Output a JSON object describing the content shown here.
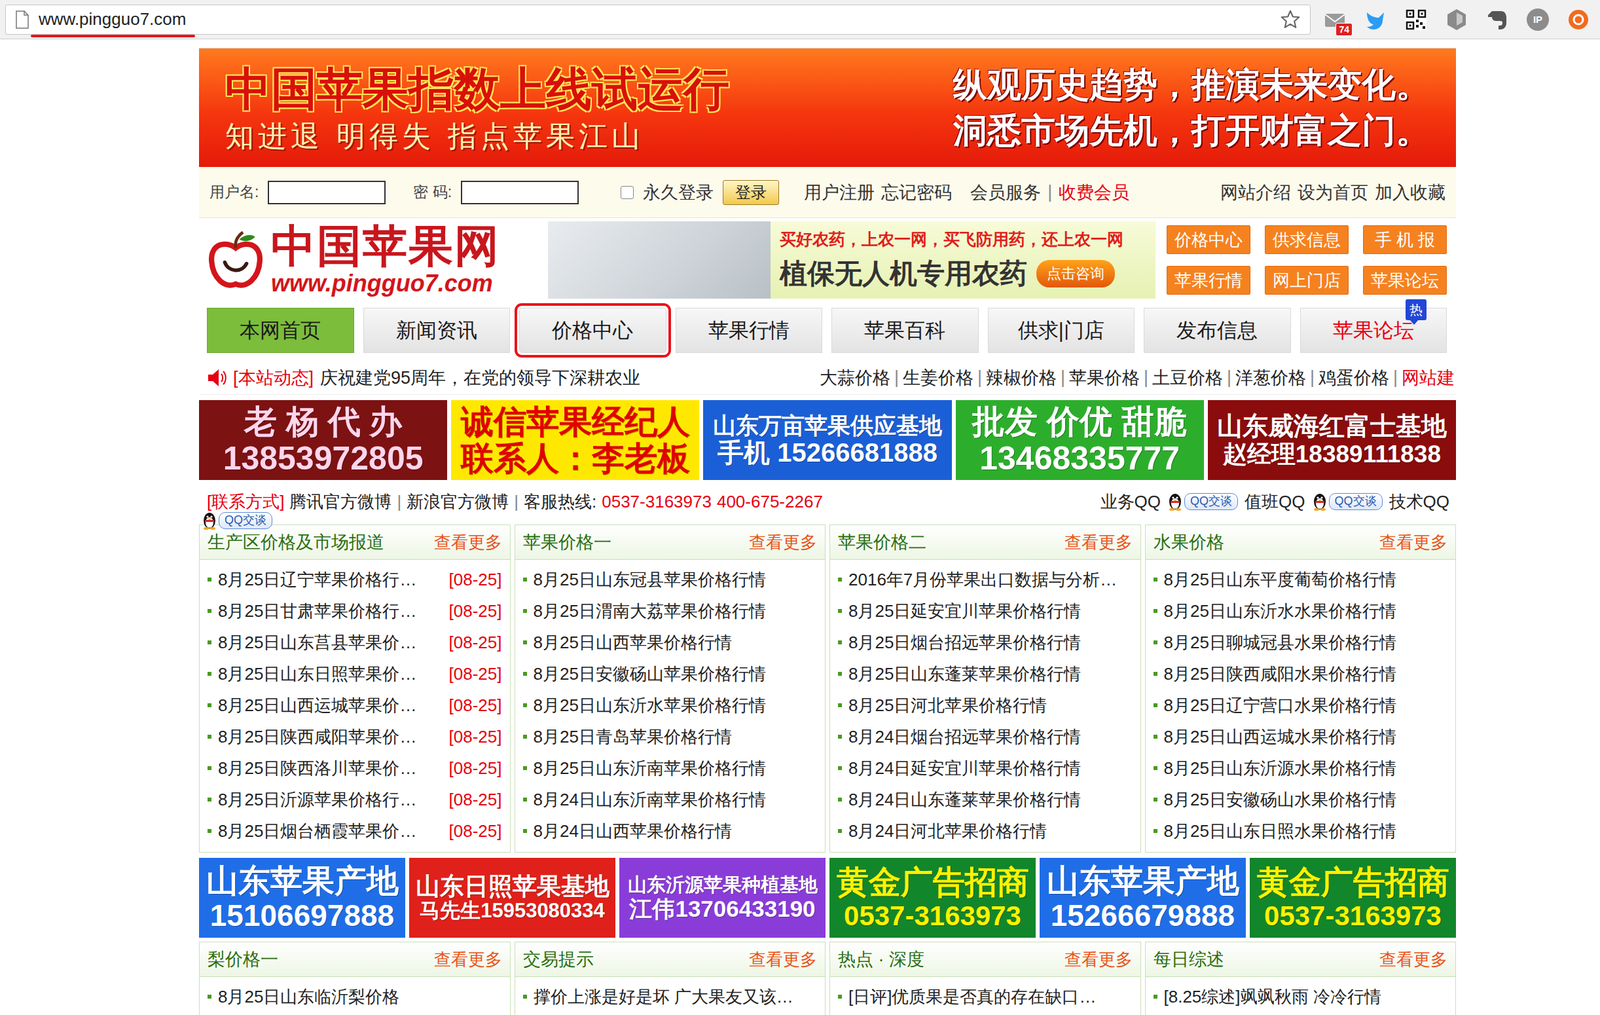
{
  "browser": {
    "url": "www.pingguo7.com",
    "url_underlined": true,
    "extensions": [
      {
        "kind": "mail",
        "badge": "74"
      },
      {
        "kind": "bird"
      },
      {
        "kind": "qr"
      },
      {
        "kind": "shield"
      },
      {
        "kind": "elephant"
      },
      {
        "kind": "ip",
        "label": "IP"
      },
      {
        "kind": "ring"
      }
    ]
  },
  "banner": {
    "headline": "中国苹果指数上线试运行",
    "slogan": "知进退 明得失 指点苹果江山",
    "lines": [
      "纵观历史趋势，推演未来变化。",
      "洞悉市场先机，打开财富之门。"
    ]
  },
  "login": {
    "username_label": "用户名:",
    "username": "",
    "password_label": "密 码:",
    "password": "",
    "remember": {
      "label": "永久登录",
      "checked": false
    },
    "submit": "登录",
    "account_links": [
      "用户注册",
      "忘记密码"
    ],
    "member_link": "会员服务",
    "member_separator": "|",
    "paid_link": "收费会员",
    "site_links": [
      "网站介绍",
      "设为首页",
      "加入收藏"
    ]
  },
  "logo": {
    "name": "中国苹果网",
    "domain": "www.pingguo7.com"
  },
  "promo": {
    "tagline": "买好农药，上农一网，买飞防用药，还上农一网",
    "title": "植保无人机专用农药",
    "button": "点击咨询"
  },
  "quick_links": [
    "价格中心",
    "供求信息",
    "手 机 报",
    "苹果行情",
    "网上门店",
    "苹果论坛"
  ],
  "nav": [
    {
      "label": "本网首页",
      "selected": true,
      "outlined": false,
      "color": "#1a1a1a"
    },
    {
      "label": "新闻资讯",
      "selected": false,
      "outlined": false,
      "color": "#1a1a1a"
    },
    {
      "label": "价格中心",
      "selected": false,
      "outlined": true,
      "color": "#1a1a1a"
    },
    {
      "label": "苹果行情",
      "selected": false,
      "outlined": false,
      "color": "#1a1a1a"
    },
    {
      "label": "苹果百科",
      "selected": false,
      "outlined": false,
      "color": "#1a1a1a"
    },
    {
      "label": "供求|门店",
      "selected": false,
      "outlined": false,
      "color": "#1a1a1a"
    },
    {
      "label": "发布信息",
      "selected": false,
      "outlined": false,
      "color": "#1a1a1a"
    },
    {
      "label": "苹果论坛",
      "selected": false,
      "outlined": false,
      "color": "#e60012",
      "badge": "热"
    }
  ],
  "ticker": {
    "tag": "[本站动态]",
    "message": "庆祝建党95周年，在党的领导下深耕农业",
    "separator": "|",
    "links": [
      {
        "text": "大蒜价格",
        "color": "#222222"
      },
      {
        "text": "生姜价格",
        "color": "#222222"
      },
      {
        "text": "辣椒价格",
        "color": "#222222"
      },
      {
        "text": "苹果价格",
        "color": "#222222"
      },
      {
        "text": "土豆价格",
        "color": "#222222"
      },
      {
        "text": "洋葱价格",
        "color": "#222222"
      },
      {
        "text": "鸡蛋价格",
        "color": "#222222"
      },
      {
        "text": "网站建",
        "color": "#e60012"
      }
    ]
  },
  "ads_top": [
    {
      "lines": [
        "老 杨 代 办",
        "13853972805"
      ],
      "color": "#7d1212",
      "text_color": "#ffd6ec"
    },
    {
      "lines": [
        "诚信苹果经纪人",
        "联系人：李老板"
      ],
      "color": "#ffe800",
      "text_color": "#e00000"
    },
    {
      "lines": [
        "山东万亩苹果供应基地",
        "手机 15266681888"
      ],
      "color": "#1b5fd6",
      "text_color": "#ffffff"
    },
    {
      "lines": [
        "批发 价优 甜脆",
        "13468335777"
      ],
      "color": "#2cae2c",
      "text_color": "#ffffff"
    },
    {
      "lines": [
        "山东威海红富士基地",
        "赵经理18389111838"
      ],
      "color": "#8b0c0c",
      "text_color": "#ffffff"
    }
  ],
  "contact": {
    "tag": "[联系方式]",
    "links": [
      "腾讯官方微博",
      "新浪官方微博"
    ],
    "separator": "|",
    "hotline_label": "客服热线:",
    "hotlines": [
      "0537-3163973",
      "400-675-2267"
    ],
    "qq": [
      {
        "label": "业务QQ",
        "badge": "QQ交谈",
        "wrapped": false
      },
      {
        "label": "值班QQ",
        "badge": "QQ交谈",
        "wrapped": false
      },
      {
        "label": "技术QQ",
        "badge": "QQ交谈",
        "wrapped": true
      }
    ]
  },
  "panels": [
    {
      "title": "生产区价格及市场报道",
      "more": "查看更多",
      "items": [
        {
          "text": "8月25日辽宁苹果价格行…",
          "date": "[08-25]"
        },
        {
          "text": "8月25日甘肃苹果价格行…",
          "date": "[08-25]"
        },
        {
          "text": "8月25日山东莒县苹果价…",
          "date": "[08-25]"
        },
        {
          "text": "8月25日山东日照苹果价…",
          "date": "[08-25]"
        },
        {
          "text": "8月25日山西运城苹果价…",
          "date": "[08-25]"
        },
        {
          "text": "8月25日陕西咸阳苹果价…",
          "date": "[08-25]"
        },
        {
          "text": "8月25日陕西洛川苹果价…",
          "date": "[08-25]"
        },
        {
          "text": "8月25日沂源苹果价格行…",
          "date": "[08-25]"
        },
        {
          "text": "8月25日烟台栖霞苹果价…",
          "date": "[08-25]"
        }
      ]
    },
    {
      "title": "苹果价格一",
      "more": "查看更多",
      "items": [
        {
          "text": "8月25日山东冠县苹果价格行情"
        },
        {
          "text": "8月25日渭南大荔苹果价格行情"
        },
        {
          "text": "8月25日山西苹果价格行情"
        },
        {
          "text": "8月25日安徽砀山苹果价格行情"
        },
        {
          "text": "8月25日山东沂水苹果价格行情"
        },
        {
          "text": "8月25日青岛苹果价格行情"
        },
        {
          "text": "8月25日山东沂南苹果价格行情"
        },
        {
          "text": "8月24日山东沂南苹果价格行情"
        },
        {
          "text": "8月24日山西苹果价格行情"
        }
      ]
    },
    {
      "title": "苹果价格二",
      "more": "查看更多",
      "items": [
        {
          "text": "2016年7月份苹果出口数据与分析…"
        },
        {
          "text": "8月25日延安宜川苹果价格行情"
        },
        {
          "text": "8月25日烟台招远苹果价格行情"
        },
        {
          "text": "8月25日山东蓬莱苹果价格行情"
        },
        {
          "text": "8月25日河北苹果价格行情"
        },
        {
          "text": "8月24日烟台招远苹果价格行情"
        },
        {
          "text": "8月24日延安宜川苹果价格行情"
        },
        {
          "text": "8月24日山东蓬莱苹果价格行情"
        },
        {
          "text": "8月24日河北苹果价格行情"
        }
      ]
    },
    {
      "title": "水果价格",
      "more": "查看更多",
      "items": [
        {
          "text": "8月25日山东平度葡萄价格行情"
        },
        {
          "text": "8月25日山东沂水水果价格行情"
        },
        {
          "text": "8月25日聊城冠县水果价格行情"
        },
        {
          "text": "8月25日陕西咸阳水果价格行情"
        },
        {
          "text": "8月25日辽宁营口水果价格行情"
        },
        {
          "text": "8月25日山西运城水果价格行情"
        },
        {
          "text": "8月25日山东沂源水果价格行情"
        },
        {
          "text": "8月25日安徽砀山水果价格行情"
        },
        {
          "text": "8月25日山东日照水果价格行情"
        }
      ]
    }
  ],
  "ads_bottom": [
    {
      "lines": [
        "山东苹果产地",
        "15106697888"
      ],
      "color": "#1f6ee8",
      "text_color": "#ffffff"
    },
    {
      "lines": [
        "山东日照苹果基地",
        "马先生15953080334"
      ],
      "color": "#e0201a",
      "text_color": "#ffffff"
    },
    {
      "lines": [
        "山东沂源苹果种植基地",
        "江伟13706433190"
      ],
      "color": "#8a3cd8",
      "text_color": "#ffffff"
    },
    {
      "lines": [
        "黄金广告招商",
        "0537-3163973"
      ],
      "color": "#12862a",
      "text_color": "#fff200"
    },
    {
      "lines": [
        "山东苹果产地",
        "15266679888"
      ],
      "color": "#1f6ee8",
      "text_color": "#ffffff"
    },
    {
      "lines": [
        "黄金广告招商",
        "0537-3163973"
      ],
      "color": "#12862a",
      "text_color": "#fff200"
    }
  ],
  "panels_bottom": [
    {
      "title": "梨价格一",
      "more": "查看更多",
      "items": [
        {
          "text": "8月25日山东临沂梨价格"
        }
      ]
    },
    {
      "title": "交易提示",
      "more": "查看更多",
      "items": [
        {
          "text": "撑价上涨是好是坏 广大果友又该…"
        }
      ]
    },
    {
      "title": "热点 · 深度",
      "more": "查看更多",
      "items": [
        {
          "text": "[日评]优质果是否真的存在缺口…"
        }
      ]
    },
    {
      "title": "每日综述",
      "more": "查看更多",
      "items": [
        {
          "text": "[8.25综述]飒飒秋雨 冷冷行情"
        }
      ]
    }
  ]
}
